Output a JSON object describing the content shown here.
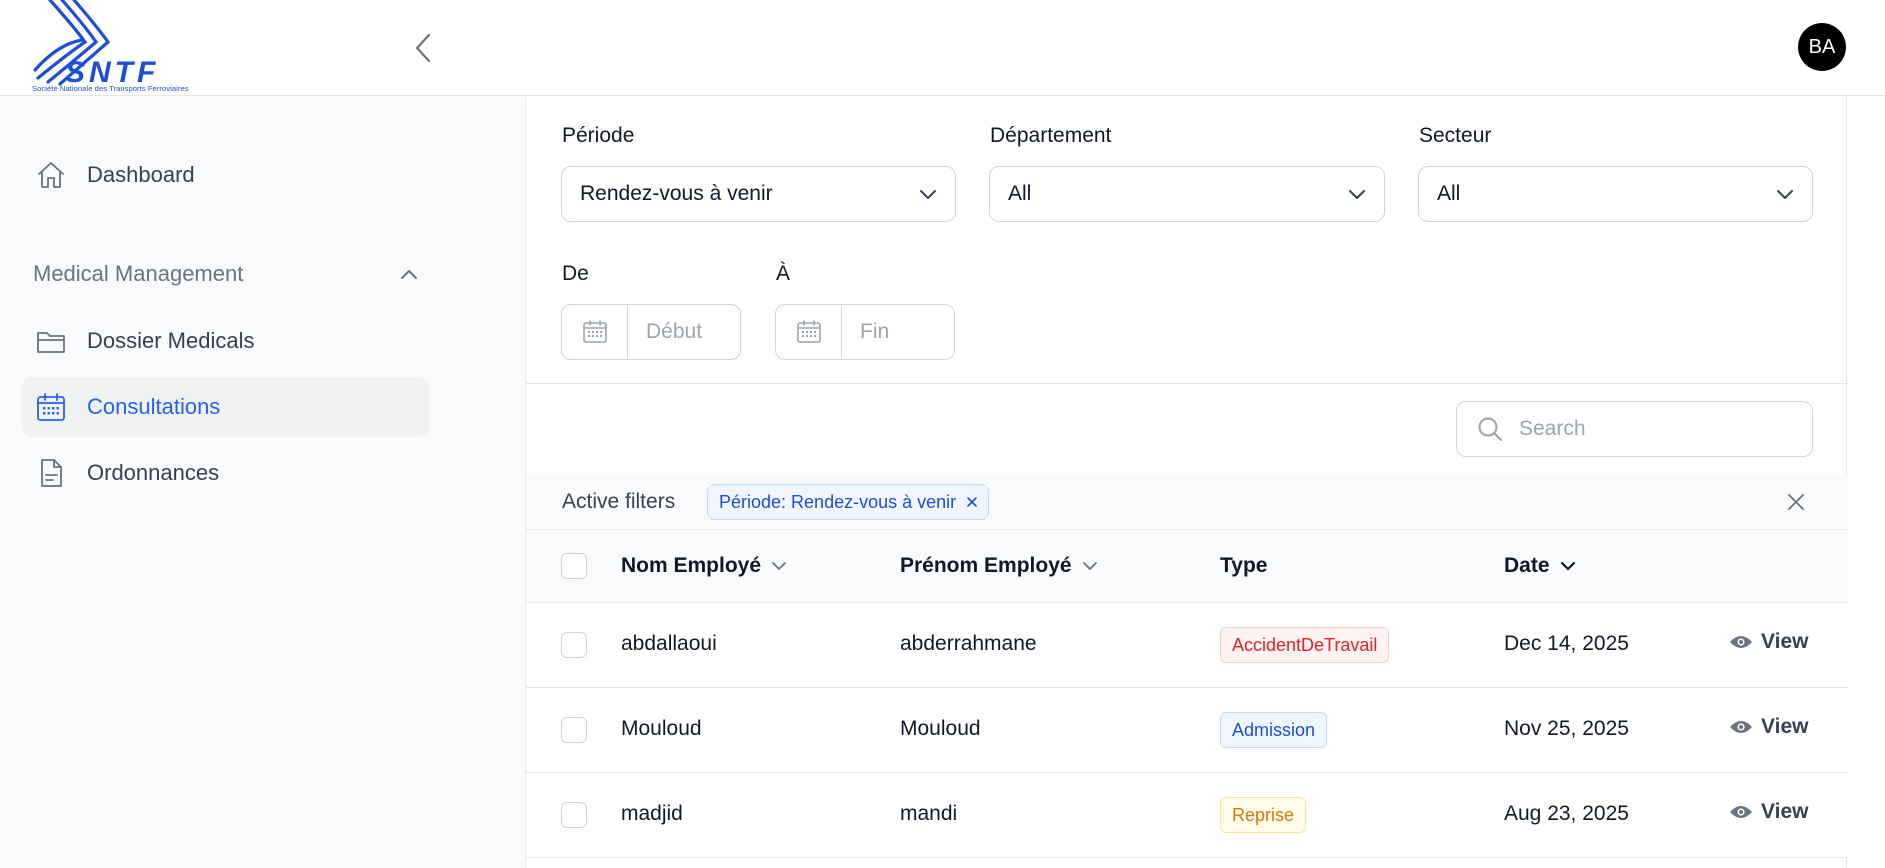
{
  "brand": {
    "logo_text": "SNTF",
    "logo_subtitle": "Société Nationale des Transports Ferroviaires",
    "color": "#1d4ed8"
  },
  "header": {
    "avatar_initials": "BA"
  },
  "sidebar": {
    "dashboard_label": "Dashboard",
    "section": {
      "label": "Medical Management",
      "expanded": true
    },
    "items": [
      {
        "label": "Dossier Medicals",
        "icon": "folder-icon",
        "active": false
      },
      {
        "label": "Consultations",
        "icon": "calendar-icon",
        "active": true
      },
      {
        "label": "Ordonnances",
        "icon": "document-icon",
        "active": false
      }
    ]
  },
  "filters": {
    "periode": {
      "label": "Période",
      "value": "Rendez-vous à venir"
    },
    "departement": {
      "label": "Département",
      "value": "All"
    },
    "secteur": {
      "label": "Secteur",
      "value": "All"
    },
    "de": {
      "label": "De",
      "placeholder": "Début"
    },
    "a": {
      "label": "À",
      "placeholder": "Fin"
    }
  },
  "search": {
    "placeholder": "Search"
  },
  "active_filters": {
    "title": "Active filters",
    "chips": [
      {
        "label": "Période: Rendez-vous à venir"
      }
    ]
  },
  "table": {
    "columns": {
      "nom": "Nom Employé",
      "prenom": "Prénom Employé",
      "type": "Type",
      "date": "Date"
    },
    "view_label": "View",
    "rows": [
      {
        "nom": "abdallaoui",
        "prenom": "abderrahmane",
        "type": "AccidentDeTravail",
        "date": "Dec 14, 2025"
      },
      {
        "nom": "Mouloud",
        "prenom": "Mouloud",
        "type": "Admission",
        "date": "Nov 25, 2025"
      },
      {
        "nom": "madjid",
        "prenom": "mandi",
        "type": "Reprise",
        "date": "Aug 23, 2025"
      }
    ]
  },
  "badge_colors": {
    "AccidentDeTravail": {
      "text": "#dc2626",
      "bg": "#fef2f2",
      "border": "#fecaca"
    },
    "Admission": {
      "text": "#1d4ed8",
      "bg": "#eff6ff",
      "border": "#bfdbfe"
    },
    "Reprise": {
      "text": "#d97706",
      "bg": "#fffbeb",
      "border": "#fde68a"
    }
  },
  "accent_color": "#2563eb"
}
